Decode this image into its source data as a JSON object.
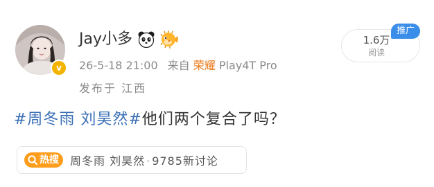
{
  "post": {
    "author": {
      "name": "Jay小多",
      "avatar_icon": "avatar-photo",
      "verified_icon": "v-badge-icon",
      "verified_glyph": "v",
      "emojis": [
        "panda-emoji-icon",
        "pufferfish-emoji-icon"
      ]
    },
    "meta": {
      "timestamp": "26-5-18 21:00",
      "source_prefix": "来自",
      "device_brand": "荣耀",
      "device_model": "Play4T Pro",
      "location": "发布于 江西"
    },
    "stats": {
      "read_count": "1.6万",
      "read_label": "阅读",
      "promo_tag": "推广"
    },
    "content": {
      "topic": "#周冬雨 刘昊然#",
      "text": "他们两个复合了吗？"
    },
    "hot_search": {
      "badge": "热搜",
      "keyword": "周冬雨 刘昊然",
      "separator": "·",
      "discussion": "9785新讨论"
    }
  },
  "colors": {
    "topic_link": "#3a6fb5",
    "device_brand": "#ea7a1b",
    "promo_tag_bg": "#3a8eea",
    "hot_badge_bg": "#ff9d1c",
    "verified_badge": "#f2b400"
  }
}
